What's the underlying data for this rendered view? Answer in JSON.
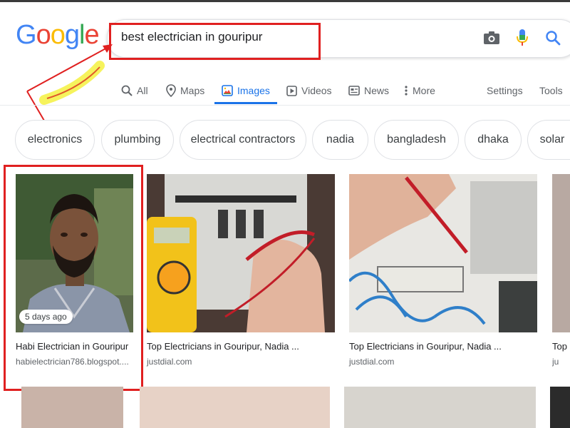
{
  "logo": {
    "letters": [
      "G",
      "o",
      "o",
      "g",
      "l",
      "e"
    ],
    "colors": [
      "#4285F4",
      "#EA4335",
      "#FBBC05",
      "#4285F4",
      "#34A853",
      "#EA4335"
    ]
  },
  "search": {
    "query": "best electrician in gouripur"
  },
  "icons": {
    "camera": "camera-icon",
    "mic": "mic-icon",
    "search": "search-icon"
  },
  "tabs": [
    {
      "label": "All",
      "icon": "search-icon"
    },
    {
      "label": "Maps",
      "icon": "map-pin-icon"
    },
    {
      "label": "Images",
      "icon": "image-icon",
      "active": true
    },
    {
      "label": "Videos",
      "icon": "play-icon"
    },
    {
      "label": "News",
      "icon": "news-icon"
    },
    {
      "label": "More",
      "icon": "more-vertical-icon"
    }
  ],
  "tools": {
    "settings": "Settings",
    "tools": "Tools"
  },
  "chips": [
    "electronics",
    "plumbing",
    "electrical contractors",
    "nadia",
    "bangladesh",
    "dhaka",
    "solar"
  ],
  "results": [
    {
      "title": "Habi Electrician in Gouripur",
      "domain": "habielectrician786.blogspot....",
      "badge": "5 days ago"
    },
    {
      "title": "Top Electricians in Gouripur, Nadia ...",
      "domain": "justdial.com"
    },
    {
      "title": "Top Electricians in Gouripur, Nadia ...",
      "domain": "justdial.com"
    },
    {
      "title": "Top",
      "domain": "ju"
    }
  ],
  "colors": {
    "accent": "#1a73e8",
    "annotation_red": "#e02020",
    "annotation_yellow": "#f5f24a"
  }
}
